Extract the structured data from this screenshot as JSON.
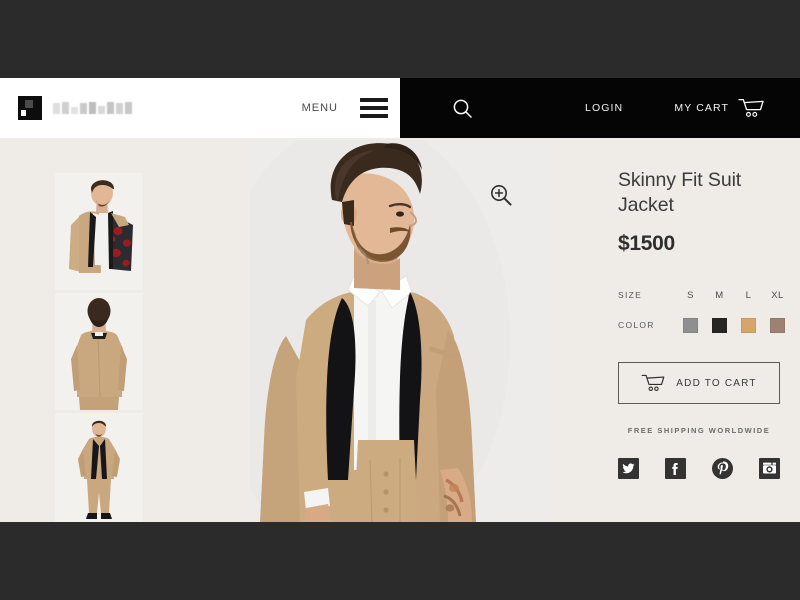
{
  "theme": {
    "page_bg": "#efece8",
    "outer_bg": "#2b2b2b",
    "header_left_bg": "#ffffff",
    "header_right_bg": "#050505",
    "badge_bg": "#4a4a4a",
    "text_dark": "#3b3b3b",
    "icon_dark": "#3b3b3b"
  },
  "header": {
    "logo": {
      "name": "brand-logo",
      "text_blurred": true
    },
    "menu_label": "MENU",
    "hamburger_icon": "hamburger-icon",
    "search_icon": "search-icon",
    "login_label": "LOGIN",
    "cart_label": "MY CART",
    "cart_icon": "shopping-cart-icon",
    "cart_count": "0"
  },
  "gallery": {
    "zoom_icon": "zoom-in-icon",
    "thumbnails": [
      {
        "name": "thumbnail-1",
        "alt": "Model opening camel suit jacket showing floral lining"
      },
      {
        "name": "thumbnail-2",
        "alt": "Back view of camel suit jacket"
      },
      {
        "name": "thumbnail-3",
        "alt": "Full length view of camel suit"
      }
    ],
    "main_image": {
      "name": "main-product-image",
      "alt": "Bearded model wearing camel skinny fit suit jacket with black shawl lapel"
    }
  },
  "product": {
    "title": "Skinny Fit Suit Jacket",
    "price": "$1500",
    "size": {
      "label": "SIZE",
      "options": [
        "S",
        "M",
        "L",
        "XL"
      ]
    },
    "color": {
      "label": "COLOR",
      "options": [
        {
          "name": "grey",
          "hex": "#8e8f91",
          "pattern": "dotted"
        },
        {
          "name": "charcoal",
          "hex": "#262626",
          "pattern": "solid"
        },
        {
          "name": "camel",
          "hex": "#d6a56c",
          "pattern": "solid"
        },
        {
          "name": "taupe",
          "hex": "#9c8272",
          "pattern": "solid"
        }
      ]
    },
    "add_to_cart_label": "ADD TO CART",
    "add_to_cart_icon": "shopping-cart-icon",
    "shipping_note": "FREE SHIPPING WORLDWIDE"
  },
  "socials": [
    {
      "name": "twitter-icon",
      "label": "Twitter"
    },
    {
      "name": "facebook-icon",
      "label": "Facebook"
    },
    {
      "name": "pinterest-icon",
      "label": "Pinterest"
    },
    {
      "name": "instagram-icon",
      "label": "Instagram"
    }
  ]
}
